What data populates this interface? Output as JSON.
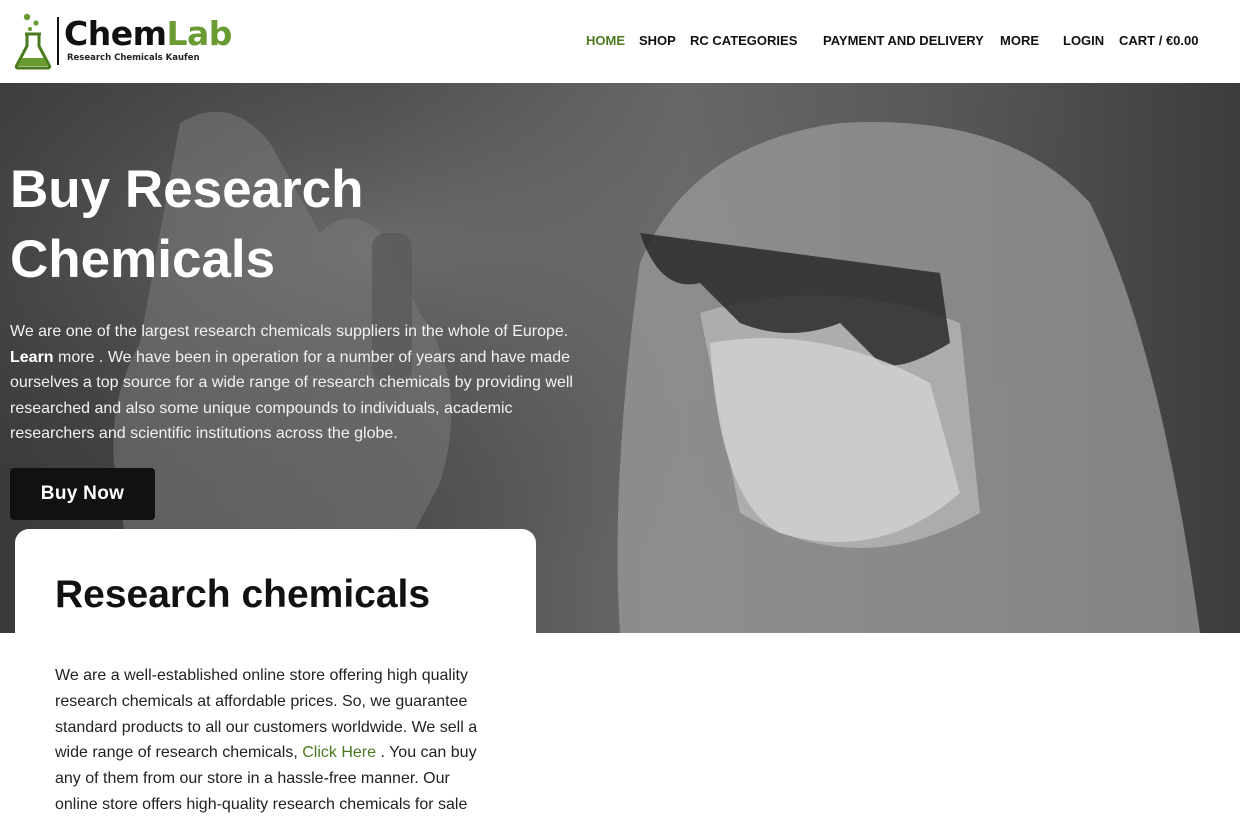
{
  "brand": {
    "name_part1": "Chem",
    "name_part2": "Lab",
    "tagline": "Research Chemicals Kaufen",
    "accent_color": "#6a9a32"
  },
  "nav": {
    "items": [
      {
        "label": "HOME",
        "active": true
      },
      {
        "label": "SHOP",
        "active": false
      },
      {
        "label": "RC CATEGORIES",
        "active": false
      },
      {
        "label": "PAYMENT AND DELIVERY",
        "active": false
      },
      {
        "label": "MORE",
        "active": false
      },
      {
        "label": "LOGIN",
        "active": false
      },
      {
        "label": "CART / €0.00",
        "active": false
      }
    ]
  },
  "hero": {
    "title": "Buy Research Chemicals",
    "text_part1": "We are one of the largest research chemicals suppliers in the whole of Europe.",
    "text_bold": "Learn",
    "text_part2": "more . We have been in operation for a number of years and have made ourselves a top source for a wide range of research chemicals by providing well researched and also some unique compounds to individuals, academic researchers and scientific institutions across the globe.",
    "button_label": "Buy Now"
  },
  "intro_card": {
    "title": "Research chemicals",
    "text_part1": "We are a well-established online store offering high quality research chemicals at affordable prices. So, we guarantee standard products to all our customers worldwide. We sell a wide range of research chemicals,",
    "link_label": "Click Here",
    "text_part2": ". You can buy any of them from our store in a hassle-free manner. Our online store offers high-quality research chemicals for sale"
  }
}
